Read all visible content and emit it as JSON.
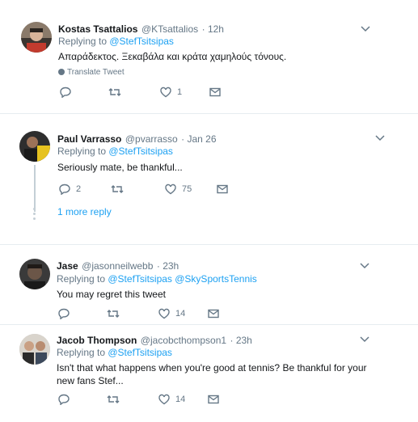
{
  "tweets": [
    {
      "name": "Kostas Tsattalios",
      "handle": "@KTsattalios",
      "time": "· 12h",
      "replying_prefix": "Replying to ",
      "replying_to": "@StefTsitsipas",
      "text": "Απαράδεκτος. Ξεκαβάλα και κράτα χαμηλούς τόνους.",
      "translate": "Translate Tweet",
      "likes": "1"
    },
    {
      "name": "Paul Varrasso",
      "handle": "@pvarrasso",
      "time": "· Jan 26",
      "replying_prefix": "Replying to ",
      "replying_to": "@StefTsitsipas",
      "text": "Seriously mate, be thankful...",
      "replies": "2",
      "likes": "75",
      "more_reply": "1 more reply"
    },
    {
      "name": "Jase",
      "handle": "@jasonneilwebb",
      "time": "· 23h",
      "replying_prefix": "Replying to ",
      "replying_to": "@StefTsitsipas @SkySportsTennis",
      "text": "You may regret this tweet",
      "likes": "14"
    },
    {
      "name": "Jacob Thompson",
      "handle": "@jacobcthompson1",
      "time": "· 23h",
      "replying_prefix": "Replying to ",
      "replying_to": "@StefTsitsipas",
      "text": "Isn't that what happens when you're good at tennis? Be thankful for your new fans Stef...",
      "likes": "14"
    }
  ],
  "colors": {
    "link": "#1da1f2",
    "muted": "#657786",
    "divider": "#e6ecf0"
  },
  "icons": [
    "reply-icon",
    "retweet-icon",
    "like-icon",
    "dm-icon",
    "chevron-down-icon",
    "globe-icon"
  ]
}
